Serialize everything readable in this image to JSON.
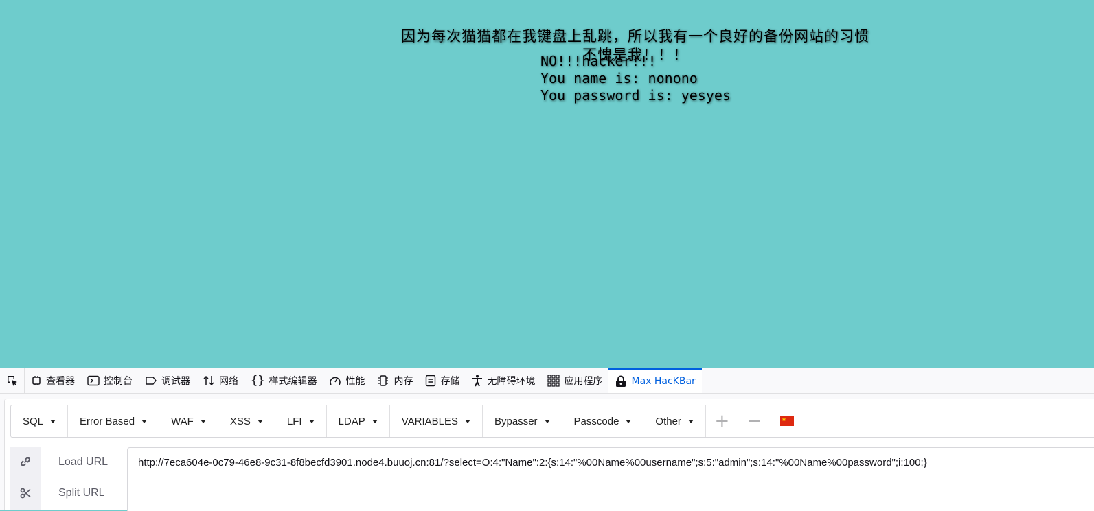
{
  "page": {
    "banner_line1": "因为每次猫猫都在我键盘上乱跳，所以我有一个良好的备份网站的习惯",
    "banner_line2": "不愧是我！！！",
    "result_line1": "NO!!!hacker!!!",
    "result_line2": "You name is: nonono",
    "result_line3": "You password is: yesyes",
    "background_color": "#6ecccc"
  },
  "devtools": {
    "tabs": [
      {
        "label": "查看器",
        "icon": "inspector-icon"
      },
      {
        "label": "控制台",
        "icon": "console-icon"
      },
      {
        "label": "调试器",
        "icon": "debugger-icon"
      },
      {
        "label": "网络",
        "icon": "network-icon"
      },
      {
        "label": "样式编辑器",
        "icon": "style-editor-icon"
      },
      {
        "label": "性能",
        "icon": "performance-icon"
      },
      {
        "label": "内存",
        "icon": "memory-icon"
      },
      {
        "label": "存储",
        "icon": "storage-icon"
      },
      {
        "label": "无障碍环境",
        "icon": "accessibility-icon"
      },
      {
        "label": "应用程序",
        "icon": "application-icon"
      },
      {
        "label": "Max HacKBar",
        "icon": "hackbar-lock-icon"
      }
    ],
    "active_tab": "Max HacKBar",
    "accent_color": "#0060df"
  },
  "hackbar": {
    "menus": [
      "SQL",
      "Error Based",
      "WAF",
      "XSS",
      "LFI",
      "LDAP",
      "VARIABLES",
      "Bypasser",
      "Passcode",
      "Other"
    ],
    "plus_symbol": "+",
    "minus_symbol": "−",
    "flag": "china-flag-icon",
    "load_url_label": "Load URL",
    "split_url_label": "Split URL",
    "url_value": "http://7eca604e-0c79-46e8-9c31-8f8becfd3901.node4.buuoj.cn:81/?select=O:4:\"Name\":2:{s:14:\"%00Name%00username\";s:5:\"admin\";s:14:\"%00Name%00password\";i:100;}"
  }
}
